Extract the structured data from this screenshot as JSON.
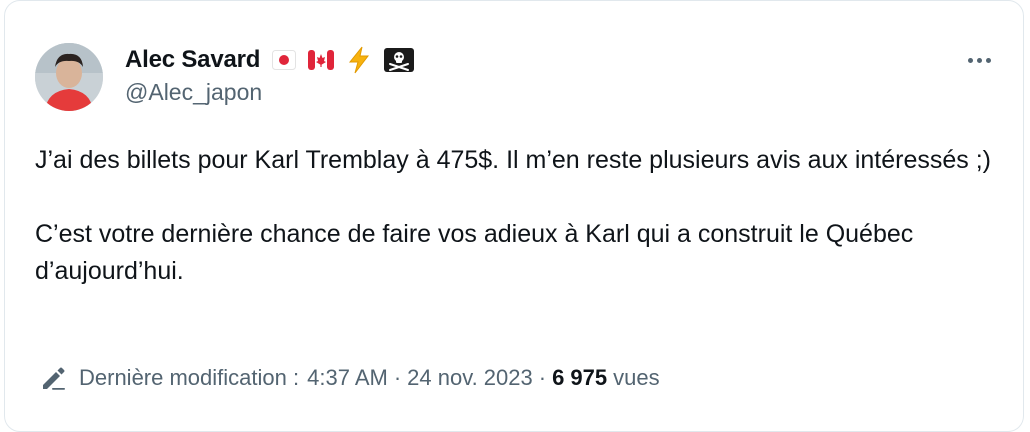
{
  "tweet": {
    "author": {
      "display_name": "Alec Savard",
      "handle": "@Alec_japon",
      "emojis": [
        "japan-flag-icon",
        "canada-flag-icon",
        "lightning-icon",
        "pirate-flag-icon"
      ]
    },
    "text_paragraphs": [
      "J’ai des billets pour Karl Tremblay à 475$. Il m’en reste plusieurs avis aux intéressés ;)",
      "C’est votre dernière chance de faire vos adieux à Karl qui a construit le Québec d’aujourd’hui."
    ],
    "meta": {
      "edited_label": "Dernière modification :",
      "time": "4:37 AM",
      "separator": "·",
      "date": "24 nov. 2023",
      "views_count": "6 975",
      "views_label": "vues"
    }
  },
  "colors": {
    "text": "#0f1419",
    "secondary": "#536471",
    "border": "#e1e8ed"
  }
}
